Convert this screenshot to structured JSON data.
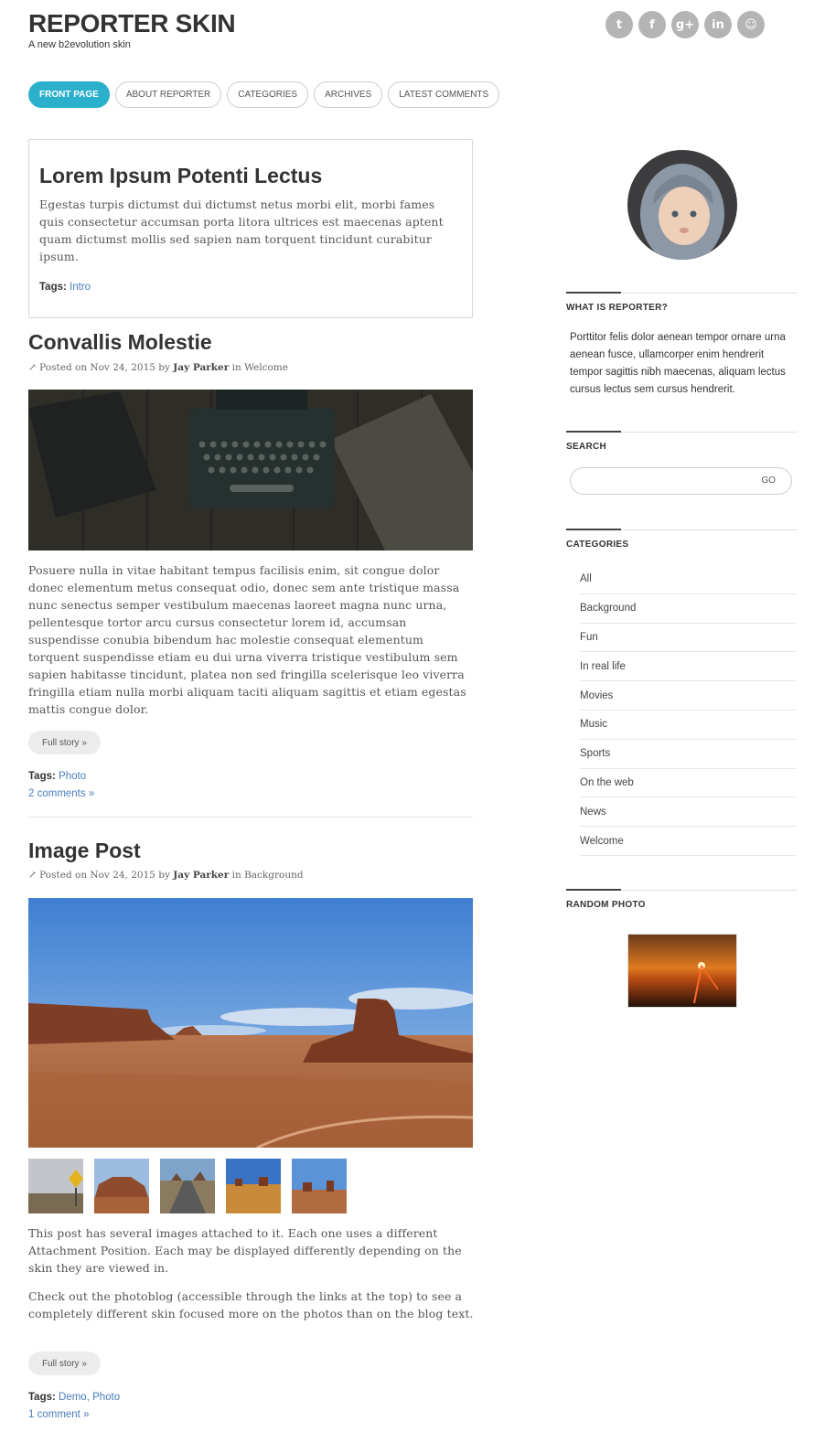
{
  "header": {
    "site_title": "REPORTER SKIN",
    "tagline": "A new b2evolution skin",
    "social": [
      {
        "icon": "twitter-icon",
        "glyph": "t"
      },
      {
        "icon": "facebook-icon",
        "glyph": "f"
      },
      {
        "icon": "google-plus-icon",
        "glyph": "g+"
      },
      {
        "icon": "linkedin-icon",
        "glyph": "in"
      },
      {
        "icon": "github-icon",
        "glyph": "☺"
      }
    ]
  },
  "nav": {
    "items": [
      "FRONT PAGE",
      "ABOUT REPORTER",
      "CATEGORIES",
      "ARCHIVES",
      "LATEST COMMENTS"
    ],
    "active_color": "#2bb0cc"
  },
  "intro": {
    "title": "Lorem Ipsum Potenti Lectus",
    "body": "Egestas turpis dictumst dui dictumst netus morbi elit, morbi fames quis consectetur accumsan porta litora ultrices est maecenas aptent quam dictumst mollis sed sapien nam torquent tincidunt curabitur ipsum.",
    "tags_label": "Tags:",
    "tags": "Intro"
  },
  "post1": {
    "title": "Convallis Molestie",
    "meta_prefix": "Posted on Nov 24, 2015 by",
    "author": "Jay Parker",
    "meta_in": "in Welcome",
    "body": "Posuere nulla in vitae habitant tempus facilisis enim, sit congue dolor donec elementum metus consequat odio, donec sem ante tristique massa nunc senectus semper vestibulum maecenas laoreet magna nunc urna, pellentesque tortor arcu cursus consectetur lorem id, accumsan suspendisse conubia bibendum hac molestie consequat elementum torquent suspendisse etiam eu dui urna viverra tristique vestibulum sem sapien habitasse tincidunt, platea non sed fringilla scelerisque leo viverra fringilla etiam nulla morbi aliquam taciti aliquam sagittis et etiam egestas mattis congue dolor.",
    "full_story": "Full story »",
    "tags_label": "Tags:",
    "tags": "Photo",
    "comments": "2 comments »"
  },
  "post2": {
    "title": "Image Post",
    "meta_prefix": "Posted on Nov 24, 2015 by",
    "author": "Jay Parker",
    "meta_in": "in Background",
    "body1": "This post has several images attached to it. Each one uses a different Attachment Position. Each may be displayed differently depending on the skin they are viewed in.",
    "body2": "Check out the photoblog (accessible through the links at the top) to see a completely different skin focused more on the photos than on the blog text.",
    "full_story": "Full story »",
    "tags_label": "Tags:",
    "tags": "Demo, Photo",
    "comments": "1 comment »"
  },
  "sidebar": {
    "about_heading": "WHAT IS REPORTER?",
    "about_text": "Porttitor felis dolor aenean tempor ornare urna aenean fusce, ullamcorper enim hendrerit tempor sagittis nibh maecenas, aliquam lectus cursus lectus sem cursus hendrerit.",
    "search_heading": "SEARCH",
    "search_button": "GO",
    "categories_heading": "CATEGORIES",
    "categories": [
      "All",
      "Background",
      "Fun",
      "In real life",
      "Movies",
      "Music",
      "Sports",
      "On the web",
      "News",
      "Welcome"
    ],
    "random_heading": "RANDOM PHOTO"
  }
}
